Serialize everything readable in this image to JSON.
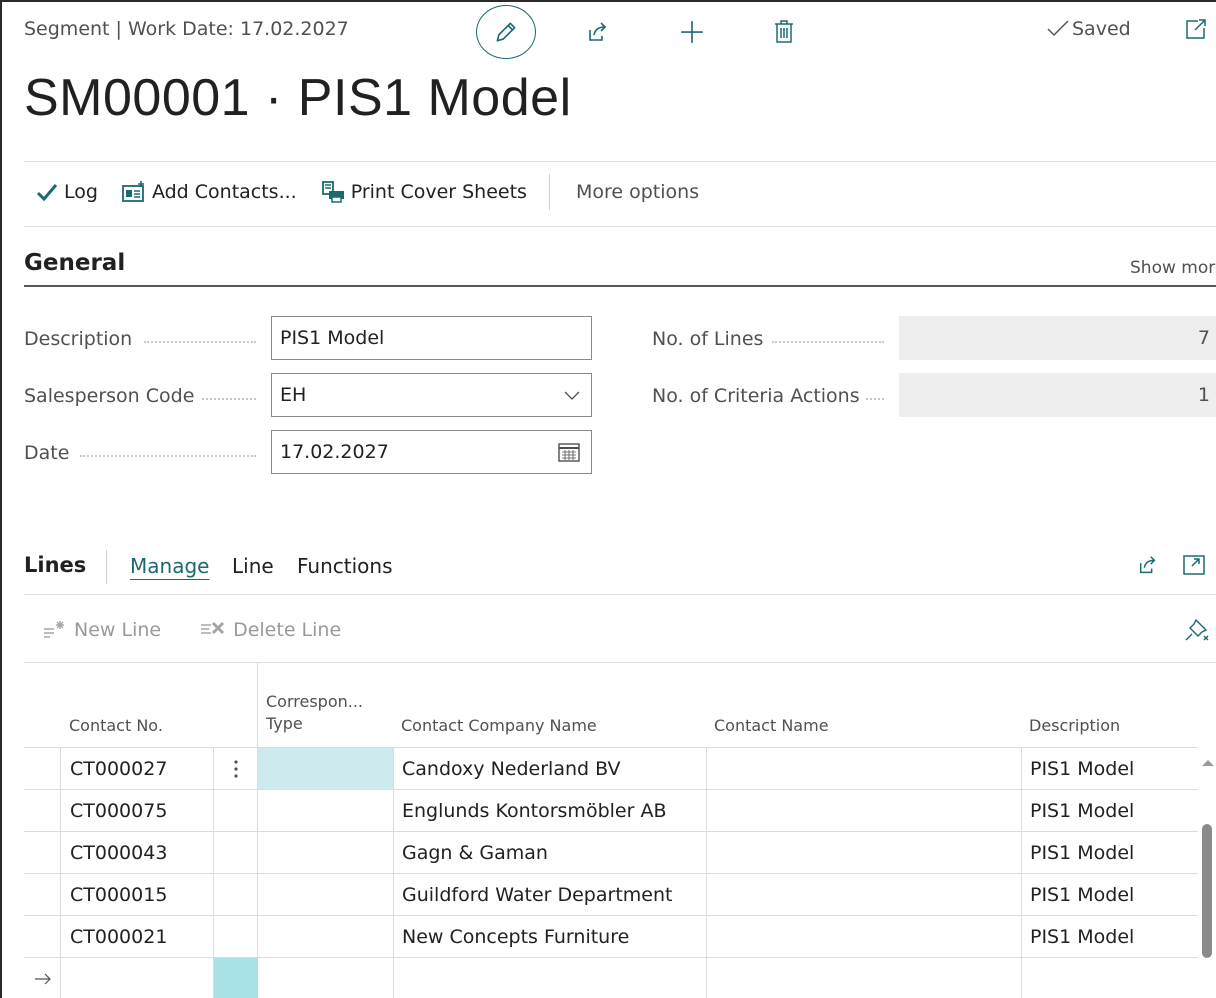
{
  "header": {
    "caption": "Segment | Work Date: 17.02.2027",
    "status": "Saved",
    "title": "SM00001 · PIS1 Model"
  },
  "actions": {
    "log": "Log",
    "add_contacts": "Add Contacts...",
    "print_cover": "Print Cover Sheets",
    "more": "More options"
  },
  "general": {
    "title": "General",
    "show_more": "Show more",
    "description_label": "Description",
    "description_value": "PIS1 Model",
    "salesperson_label": "Salesperson Code",
    "salesperson_value": "EH",
    "date_label": "Date",
    "date_value": "17.02.2027",
    "lines_label": "No. of Lines",
    "lines_value": "7",
    "criteria_label": "No. of Criteria Actions",
    "criteria_value": "1"
  },
  "lines": {
    "title": "Lines",
    "tabs": [
      "Manage",
      "Line",
      "Functions"
    ],
    "new_line": "New Line",
    "delete_line": "Delete Line",
    "columns": {
      "contact_no": "Contact No.",
      "corr_type_1": "Correspon...",
      "corr_type_2": "Type",
      "company": "Contact Company Name",
      "contact_name": "Contact Name",
      "description": "Description"
    },
    "rows": [
      {
        "contact_no": "CT000027",
        "company": "Candoxy Nederland BV",
        "name": "",
        "description": "PIS1 Model"
      },
      {
        "contact_no": "CT000075",
        "company": "Englunds Kontorsmöbler AB",
        "name": "",
        "description": "PIS1 Model"
      },
      {
        "contact_no": "CT000043",
        "company": "Gagn & Gaman",
        "name": "",
        "description": "PIS1 Model"
      },
      {
        "contact_no": "CT000015",
        "company": "Guildford Water Department",
        "name": "",
        "description": "PIS1 Model"
      },
      {
        "contact_no": "CT000021",
        "company": "New Concepts Furniture",
        "name": "",
        "description": "PIS1 Model"
      }
    ]
  }
}
